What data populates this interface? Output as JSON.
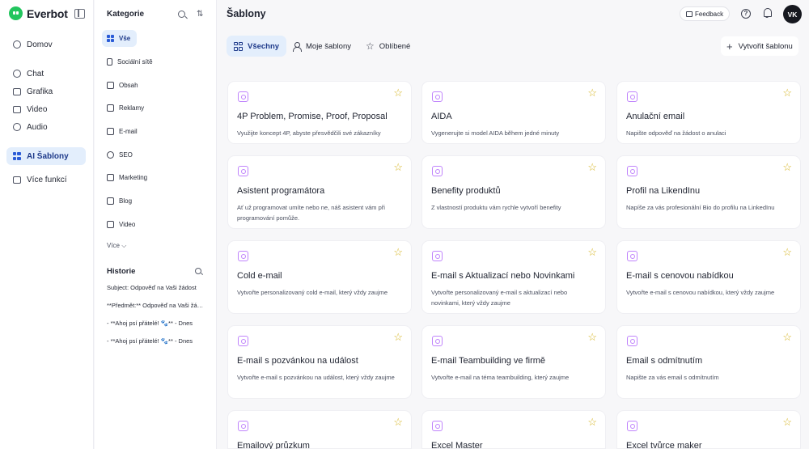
{
  "app": {
    "name": "Everbot"
  },
  "nav": {
    "items": [
      {
        "label": "Domov",
        "icon": "home-icon"
      },
      {
        "label": "Chat",
        "icon": "chat-icon"
      },
      {
        "label": "Grafika",
        "icon": "image-icon"
      },
      {
        "label": "Video",
        "icon": "video-icon"
      },
      {
        "label": "Audio",
        "icon": "audio-icon"
      },
      {
        "label": "AI Šablony",
        "icon": "grid-icon"
      },
      {
        "label": "Více funkcí",
        "icon": "more-icon"
      }
    ]
  },
  "categories": {
    "title": "Kategorie",
    "items": [
      {
        "label": "Vše"
      },
      {
        "label": "Sociální sítě"
      },
      {
        "label": "Obsah"
      },
      {
        "label": "Reklamy"
      },
      {
        "label": "E-mail"
      },
      {
        "label": "SEO"
      },
      {
        "label": "Marketing"
      },
      {
        "label": "Blog"
      },
      {
        "label": "Video"
      }
    ],
    "more": "Více ⌵"
  },
  "history": {
    "title": "Historie",
    "items": [
      "Subject: Odpověď na Vaši žádost",
      "**Předmět:** Odpověď na Vaši žádost",
      "- **Ahoj psí přátelé! 🐾** - Dnes",
      "- **Ahoj psí přátelé! 🐾** - Dnes"
    ]
  },
  "header": {
    "title": "Šablony",
    "feedback": "Feedback",
    "avatar": "VK"
  },
  "tabs": [
    {
      "label": "Všechny"
    },
    {
      "label": "Moje šablony"
    },
    {
      "label": "Oblíbené"
    }
  ],
  "create_button": "Vytvořit šablonu",
  "templates": [
    {
      "title": "4P Problem, Promise, Proof, Proposal",
      "desc": "Využijte koncept 4P, abyste přesvědčili své zákazníky"
    },
    {
      "title": "AIDA",
      "desc": "Vygenerujte si model AIDA během jedné minuty"
    },
    {
      "title": "Anulační email",
      "desc": "Napište odpověď na žádost o anulaci"
    },
    {
      "title": "Asistent programátora",
      "desc": "Ať už programovat umíte nebo ne, náš asistent vám při programování pomůže."
    },
    {
      "title": "Benefity produktů",
      "desc": "Z vlastností produktu vám rychle vytvoří benefity"
    },
    {
      "title": "Profil na LikendInu",
      "desc": "Napíše za vás profesionální Bio do profilu na LinkedInu"
    },
    {
      "title": "Cold e-mail",
      "desc": "Vytvořte personalizovaný cold e-mail, který vždy zaujme"
    },
    {
      "title": "E-mail s Aktualizací nebo Novinkami",
      "desc": "Vytvořte personalizovaný e-mail s aktualizací nebo novinkami, který vždy zaujme"
    },
    {
      "title": "E-mail s cenovou nabídkou",
      "desc": "Vytvořte e-mail s cenovou nabídkou, který vždy zaujme"
    },
    {
      "title": "E-mail s pozvánkou na událost",
      "desc": "Vytvořte e-mail s pozvánkou na událost, který vždy zaujme"
    },
    {
      "title": "E-mail Teambuilding ve firmě",
      "desc": "Vytvořte e-mail na téma teambuilding, který zaujme"
    },
    {
      "title": "Email s odmítnutím",
      "desc": "Napište za vás email s odmítnutím"
    },
    {
      "title": "Emailový průzkum",
      "desc": ""
    },
    {
      "title": "Excel Master",
      "desc": ""
    },
    {
      "title": "Excel tvůrce maker",
      "desc": ""
    }
  ],
  "colors": {
    "accent": "#1e3a8a",
    "active_bg": "#e3eefc",
    "star": "#d4b21c",
    "card_icon": "#c084fc",
    "logo": "#22c55e"
  }
}
